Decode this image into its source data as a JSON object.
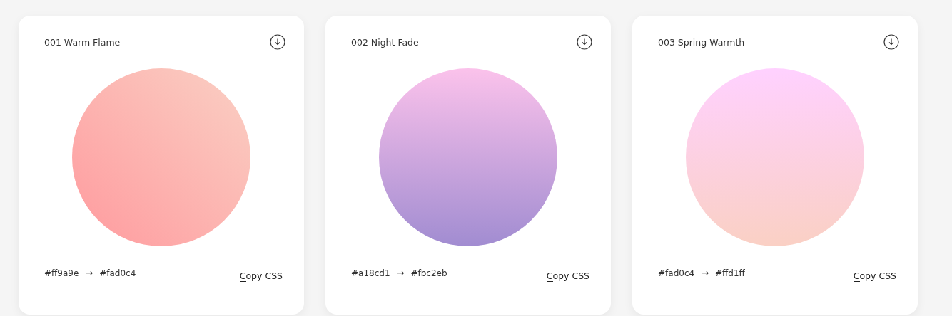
{
  "cards": [
    {
      "title": "001 Warm Flame",
      "kind": "diagonal",
      "from": "#ff9a9e",
      "arrow": "→",
      "to": "#fad0c4",
      "action": "Copy CSS"
    },
    {
      "title": "002 Night Fade",
      "kind": "vertical",
      "from": "#a18cd1",
      "arrow": "→",
      "to": "#fbc2eb",
      "action": "Copy CSS"
    },
    {
      "title": "003 Spring Warmth",
      "kind": "vertical",
      "from": "#fad0c4",
      "arrow": "→",
      "to": "#ffd1ff",
      "action": "Copy CSS"
    }
  ]
}
